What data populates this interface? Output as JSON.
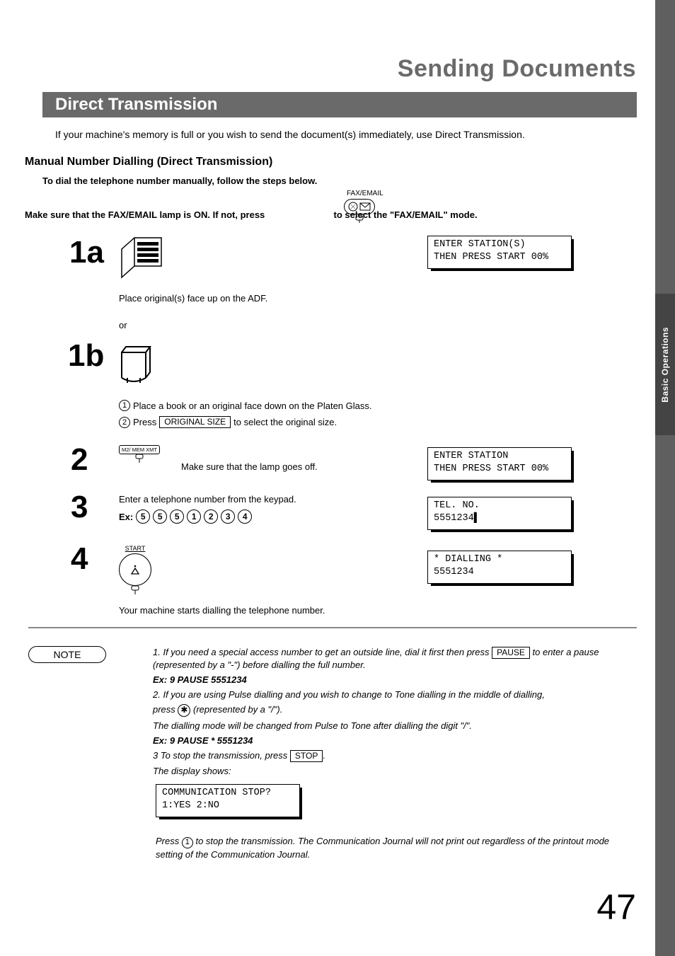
{
  "title": "Sending Documents",
  "sideTab": "Basic Operations",
  "section": "Direct Transmission",
  "intro": "If your machine's memory is full or you wish to send the document(s) immediately, use Direct Transmission.",
  "subhead": "Manual Number Dialling (Direct Transmission)",
  "boldSub": "To dial the telephone number manually, follow the steps below.",
  "modeLine": {
    "pre": "Make sure that the FAX/EMAIL lamp is ON.  If not, press",
    "post": "to select the \"FAX/EMAIL\" mode.",
    "btnLabel": "FAX/EMAIL"
  },
  "steps": {
    "s1a": {
      "num": "1a",
      "caption": "Place original(s) face up on the ADF."
    },
    "or": "or",
    "s1b": {
      "num": "1b",
      "l1": "Place a book or an original face down on the Platen Glass.",
      "l2pre": "Press",
      "l2key": "ORIGINAL  SIZE",
      "l2post": "to select the original size."
    },
    "s2": {
      "num": "2",
      "btn": "M2/    MEM XMT",
      "caption": "Make sure that the lamp goes off."
    },
    "s3": {
      "num": "3",
      "l1": "Enter a telephone number from the keypad.",
      "exLabel": "Ex:",
      "digits": [
        "5",
        "5",
        "5",
        "1",
        "2",
        "3",
        "4"
      ]
    },
    "s4": {
      "num": "4",
      "label": "START",
      "caption": "Your machine starts dialling the telephone number."
    }
  },
  "lcd": {
    "d1l1": "ENTER STATION(S)",
    "d1l2": "THEN PRESS START 00%",
    "d2l1": "ENTER STATION",
    "d2l2": "THEN PRESS START 00%",
    "d3l1": "TEL. NO.",
    "d3l2": "5551234▌",
    "d4l1": "* DIALLING *",
    "d4l2": "5551234",
    "dnl1": "COMMUNICATION STOP?",
    "dnl2": "1:YES 2:NO"
  },
  "note": {
    "label": "NOTE",
    "n1a": "1. If you need a special access number to get an outside line, dial it first then press ",
    "n1key": "PAUSE",
    "n1b": " to enter a pause (represented by a \"-\") before dialling the full number.",
    "n1ex": "Ex: 9 PAUSE 5551234",
    "n2a": "2. If you are using Pulse dialling and you wish to change to Tone dialling in the middle of dialling,",
    "n2b_pre": "press ",
    "n2b_post": " (represented by a \"/\").",
    "n2c": "The dialling mode will be changed from Pulse to Tone after dialling the digit \"/\".",
    "n2ex": "Ex: 9 PAUSE * 5551234",
    "n3a": "3  To stop the transmission, press ",
    "n3key": "  STOP  ",
    "n3b": ".",
    "n3c": "The display shows:",
    "post_pre": "Press ",
    "post_rest": " to stop the transmission. The Communication Journal will not print out regardless of the printout mode setting of the Communication Journal."
  },
  "pageNumber": "47"
}
